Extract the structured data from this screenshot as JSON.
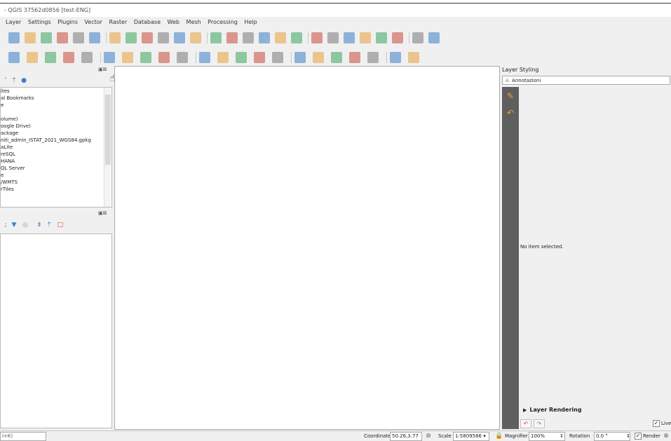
{
  "window": {
    "title": "- QGIS 37562d0856 [test-ENG]"
  },
  "menu": [
    "Layer",
    "Settings",
    "Plugins",
    "Vector",
    "Raster",
    "Database",
    "Web",
    "Mesh",
    "Processing",
    "Help"
  ],
  "browser": {
    "items": [
      "ites",
      "al Bookmarks",
      "e",
      "",
      "olume)",
      "oogle Drive)",
      "ackage",
      "niti_admin_ISTAT_2021_WGS84.gpkg",
      "aLite",
      "reSQL",
      "HANA",
      "QL Server",
      "e",
      "/WMTS",
      "rTiles"
    ]
  },
  "styling": {
    "title": "Layer Styling",
    "layer_combo": "Annotazioni",
    "empty_message": "No item selected.",
    "layer_rendering": "Layer Rendering",
    "live_update": "Live"
  },
  "status": {
    "locator": "l+K)",
    "coordinate_label": "Coordinate",
    "coordinate_value": "50.26,3.77",
    "scale_label": "Scale",
    "scale_value": "1:5809566",
    "magnifier_label": "Magnifier",
    "magnifier_value": "100%",
    "rotation_label": "Rotation",
    "rotation_value": "0.0 °",
    "render_label": "Render"
  },
  "icons": {
    "toolbar1": [
      "new-project-icon",
      "open-project-icon",
      "style-manager-icon",
      "pan-icon",
      "pan-to-selection-icon",
      "zoom-in-icon",
      "zoom-out-icon",
      "zoom-full-icon",
      "zoom-selection-icon",
      "zoom-layer-icon",
      "zoom-native-icon",
      "zoom-last-icon",
      "zoom-next-icon",
      "new-map-view-icon",
      "new-3d-view-icon",
      "bookmark-icon",
      "temporal-icon",
      "refresh-icon",
      "identify-icon",
      "attribute-table-icon",
      "processing-icon",
      "statistics-icon",
      "measure-icon",
      "annotation-icon",
      "map-tips-icon",
      "digitize-icon"
    ],
    "toolbar2": [
      "digitize-point-icon",
      "digitize-line-icon",
      "data-source-manager-icon",
      "add-vector-icon",
      "edit-pencil-icon",
      "toggle-editing-icon",
      "save-edits-icon",
      "add-feature-icon",
      "vertex-tool-icon",
      "move-feature-icon",
      "delete-feature-icon",
      "cut-icon",
      "copy-icon",
      "paste-icon",
      "undo-icon",
      "redo-icon",
      "select-icon",
      "label-icon",
      "python-icon",
      "help-icon",
      "text-annotation-icon",
      "form-annotation-icon"
    ],
    "colors": {
      "accent": "#e8a33c",
      "blue": "#3c7fc9",
      "green": "#3aa55e",
      "red": "#c94a3c"
    }
  }
}
